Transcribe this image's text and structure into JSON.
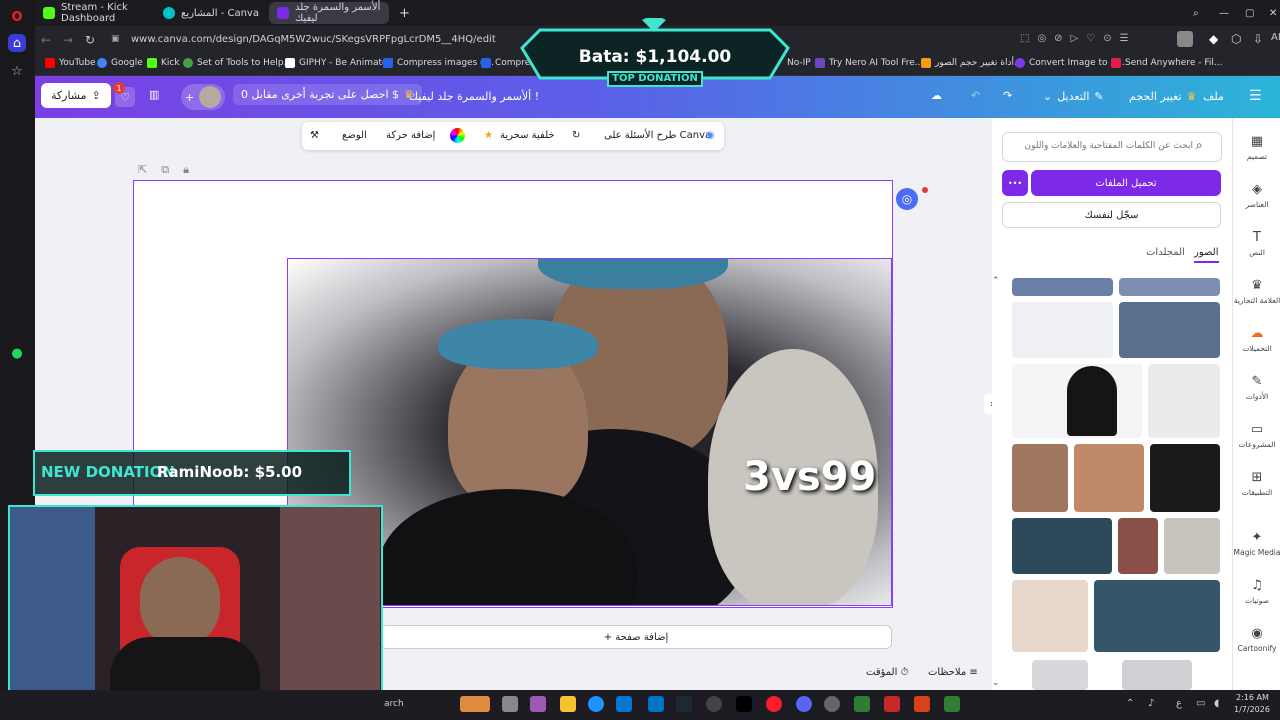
{
  "tabs": [
    {
      "label": "Stream - Kick Dashboard",
      "color": "#53fc18"
    },
    {
      "label": "المشاريع - Canva",
      "color": "#00c4cc"
    },
    {
      "label": "ألأسمر والسمرة جلد ليفيك",
      "color": "#7d2ae8"
    }
  ],
  "address": {
    "url": "www.canva.com/design/DAGqM5W2wuc/SKegsVRPFpgLcrDM5__4HQ/edit",
    "ai_label": "AI"
  },
  "bookmarks": [
    {
      "label": "YouTube",
      "color": "#ff0000"
    },
    {
      "label": "Google",
      "color": "#4285f4"
    },
    {
      "label": "Kick",
      "color": "#53fc18"
    },
    {
      "label": "Set of Tools to Help...",
      "color": "#43a047"
    },
    {
      "label": "GIPHY - Be Animated",
      "color": "#ffffff"
    },
    {
      "label": "Compress images o...",
      "color": "#2563eb"
    },
    {
      "label": "Compres",
      "color": "#2563eb"
    },
    {
      "label": "No-IP",
      "color": "#888888"
    },
    {
      "label": "Try Nero AI Tool Fre...",
      "color": "#6b46c1"
    },
    {
      "label": "أداة تغيير حجم الصور...",
      "color": "#f59e0b"
    },
    {
      "label": "Convert Image to 1...",
      "color": "#7c3aed"
    },
    {
      "label": "Send Anywhere - Fil...",
      "color": "#e11d48"
    }
  ],
  "header": {
    "share": "مشاركة",
    "notif_count": "1",
    "trial": "احصل على تجربة أخرى مقابل 0 $",
    "design_title": "ألأسمر والسمرة جلد ليفيك !",
    "edit": "التعديل",
    "resize": "تغيير الحجم",
    "file": "ملف"
  },
  "toolbar": {
    "position": "الوضع",
    "animate": "إضافة حركة",
    "magic_bg": "خلفية سحرية",
    "ask_canva": "طرح الأسئلة على Canva"
  },
  "canvas": {
    "overlay_text": "3vs99",
    "add_page": "+ إضافة صفحة",
    "timer": "المؤقت",
    "notes": "ملاحظات"
  },
  "panel": {
    "search_placeholder": "ابحث عن الكلمات المفتاحية والعلامات واللون",
    "upload": "تحميل الملفات",
    "more": "•••",
    "record": "سجّل لنفسك",
    "tab_images": "الصور",
    "tab_folders": "المجلدات"
  },
  "rail": [
    {
      "label": "تصميم",
      "icon": "▦"
    },
    {
      "label": "العناصر",
      "icon": "◈"
    },
    {
      "label": "النص",
      "icon": "T"
    },
    {
      "label": "العلامة التجارية",
      "icon": "♛"
    },
    {
      "label": "التحميلات",
      "icon": "☁"
    },
    {
      "label": "الأدوات",
      "icon": "✎"
    },
    {
      "label": "المشروعات",
      "icon": "▭"
    },
    {
      "label": "التطبيقات",
      "icon": "⊞"
    },
    {
      "label": "Magic Media",
      "icon": "✦"
    },
    {
      "label": "صوتيات",
      "icon": "♫"
    },
    {
      "label": "Cartoonify",
      "icon": "◉"
    }
  ],
  "overlays": {
    "top_donation_amount": "Bata: $1,104.00",
    "top_donation_label": "TOP DONATION",
    "new_donation_label": "NEW DONATION",
    "new_donation_text": "RamiNoob: $5.00"
  },
  "taskbar": {
    "search": "arch",
    "lang": "ع",
    "time": "2:16 AM",
    "date": "1/7/2026"
  }
}
